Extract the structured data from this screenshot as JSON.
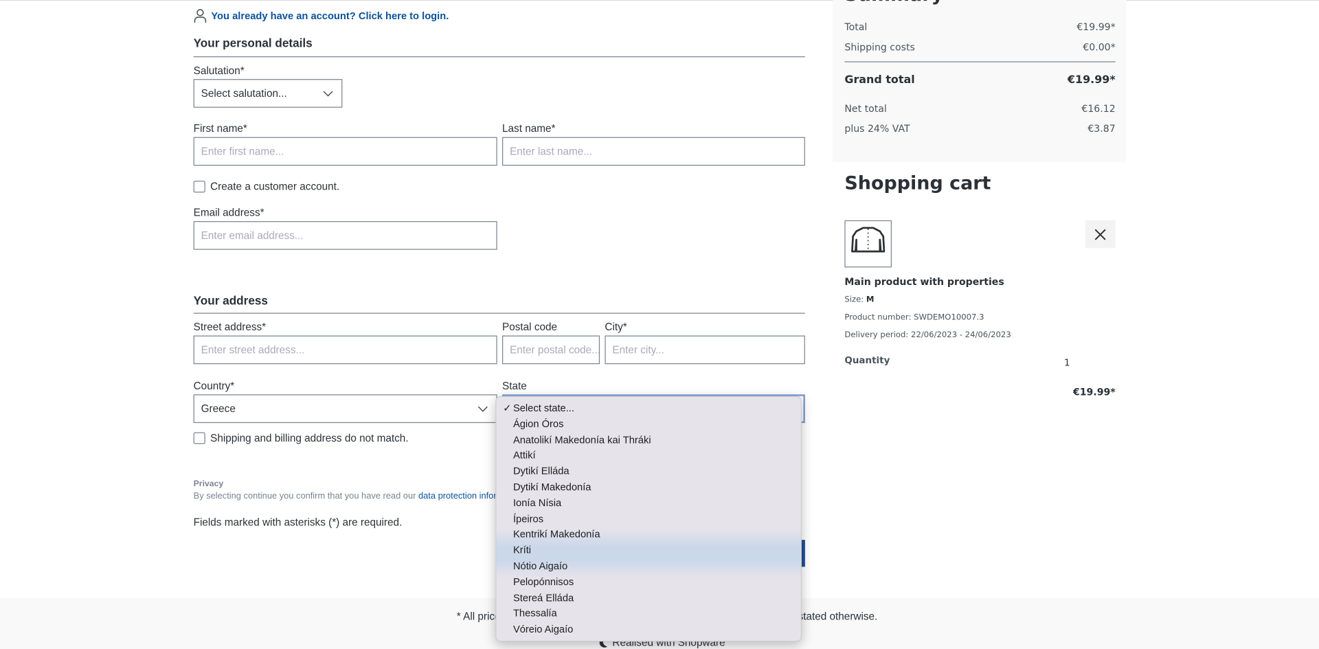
{
  "login_link": "You already have an account? Click here to login.",
  "personal": {
    "title": "Your personal details",
    "salutation_label": "Salutation*",
    "salutation_value": "Select salutation...",
    "first_name_label": "First name*",
    "first_name_placeholder": "Enter first name...",
    "last_name_label": "Last name*",
    "last_name_placeholder": "Enter last name...",
    "create_account": "Create a customer account.",
    "email_label": "Email address*",
    "email_placeholder": "Enter email address..."
  },
  "address": {
    "title": "Your address",
    "street_label": "Street address*",
    "street_placeholder": "Enter street address...",
    "postal_label": "Postal code",
    "postal_placeholder": "Enter postal code...",
    "city_label": "City*",
    "city_placeholder": "Enter city...",
    "country_label": "Country*",
    "country_value": "Greece",
    "state_label": "State",
    "different_shipping": "Shipping and billing address do not match."
  },
  "privacy": {
    "title": "Privacy",
    "text": "By selecting continue you confirm that you have read our ",
    "link": "data protection information."
  },
  "required_note": "Fields marked with asterisks (*) are required.",
  "summary": {
    "title": "Summary",
    "rows": [
      {
        "label": "Total",
        "value": "€19.99*"
      },
      {
        "label": "Shipping costs",
        "value": "€0.00*"
      },
      {
        "label": "Grand total",
        "value": "€19.99*"
      },
      {
        "label": "Net total",
        "value": "€16.12"
      },
      {
        "label": "plus 24% VAT",
        "value": "€3.87"
      }
    ]
  },
  "cart": {
    "title": "Shopping cart",
    "product_name": "Main product with properties",
    "size_label": "Size: ",
    "size_value": "M",
    "product_number": "Product number: SWDEMO10007.3",
    "delivery": "Delivery period: 22/06/2023 - 24/06/2023",
    "quantity_label": "Quantity",
    "quantity_value": "1",
    "price": "€19.99*"
  },
  "footer": {
    "prices_note": "* All prices incl. VAT plus shipping costs and possible delivery costs if not stated otherwise.",
    "realised": "Realised with Shopware"
  },
  "state_dropdown": {
    "selected": "Select state...",
    "options": [
      "Select state...",
      "Ágion Óros",
      "Anatolikí Makedonía kai Thráki",
      "Attikí",
      "Dytikí Elláda",
      "Dytikí Makedonía",
      "Ionía Nísia",
      "Ípeiros",
      "Kentrikí Makedonía",
      "Kríti",
      "Nótio Aigaío",
      "Pelopónnisos",
      "Stereá Elláda",
      "Thessalía",
      "Vóreio Aigaío"
    ]
  },
  "colors": {
    "link": "#0b539b",
    "primary_button": "#1e4f9a"
  }
}
